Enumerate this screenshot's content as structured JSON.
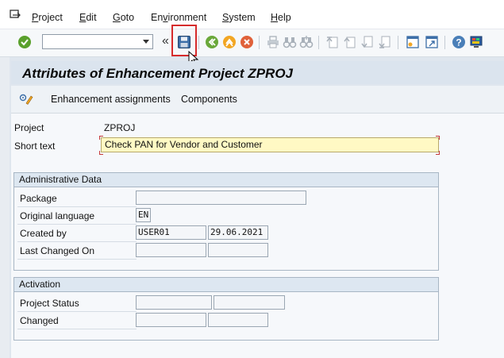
{
  "menu": {
    "items": [
      {
        "mnemonic": "P",
        "rest": "roject"
      },
      {
        "mnemonic": "E",
        "rest": "dit"
      },
      {
        "mnemonic": "G",
        "rest": "oto"
      },
      {
        "pre": "En",
        "mnemonic": "v",
        "rest": "ironment"
      },
      {
        "mnemonic": "S",
        "rest": "ystem"
      },
      {
        "mnemonic": "H",
        "rest": "elp"
      }
    ]
  },
  "toolbar": {
    "command_field_value": "",
    "collapse": "«"
  },
  "title": "Attributes of Enhancement Project ZPROJ",
  "app_toolbar": {
    "enhancement_assignments": "Enhancement assignments",
    "components": "Components"
  },
  "header_fields": {
    "project_label": "Project",
    "project_value": "ZPROJ",
    "short_text_label": "Short text",
    "short_text_value": "Check PAN for Vendor and Customer"
  },
  "admin": {
    "title": "Administrative Data",
    "package_label": "Package",
    "package_value": "",
    "original_language_label": "Original language",
    "original_language_value": "EN",
    "created_by_label": "Created by",
    "created_by_user": "USER01",
    "created_by_date": "29.06.2021",
    "last_changed_label": "Last Changed On",
    "last_changed_user": "",
    "last_changed_date": ""
  },
  "activation": {
    "title": "Activation",
    "project_status_label": "Project Status",
    "project_status_1": "",
    "project_status_2": "",
    "changed_label": "Changed",
    "changed_1": "",
    "changed_2": ""
  },
  "colors": {
    "save_highlight": "#d62b2b",
    "required_field": "#fff9c4"
  }
}
